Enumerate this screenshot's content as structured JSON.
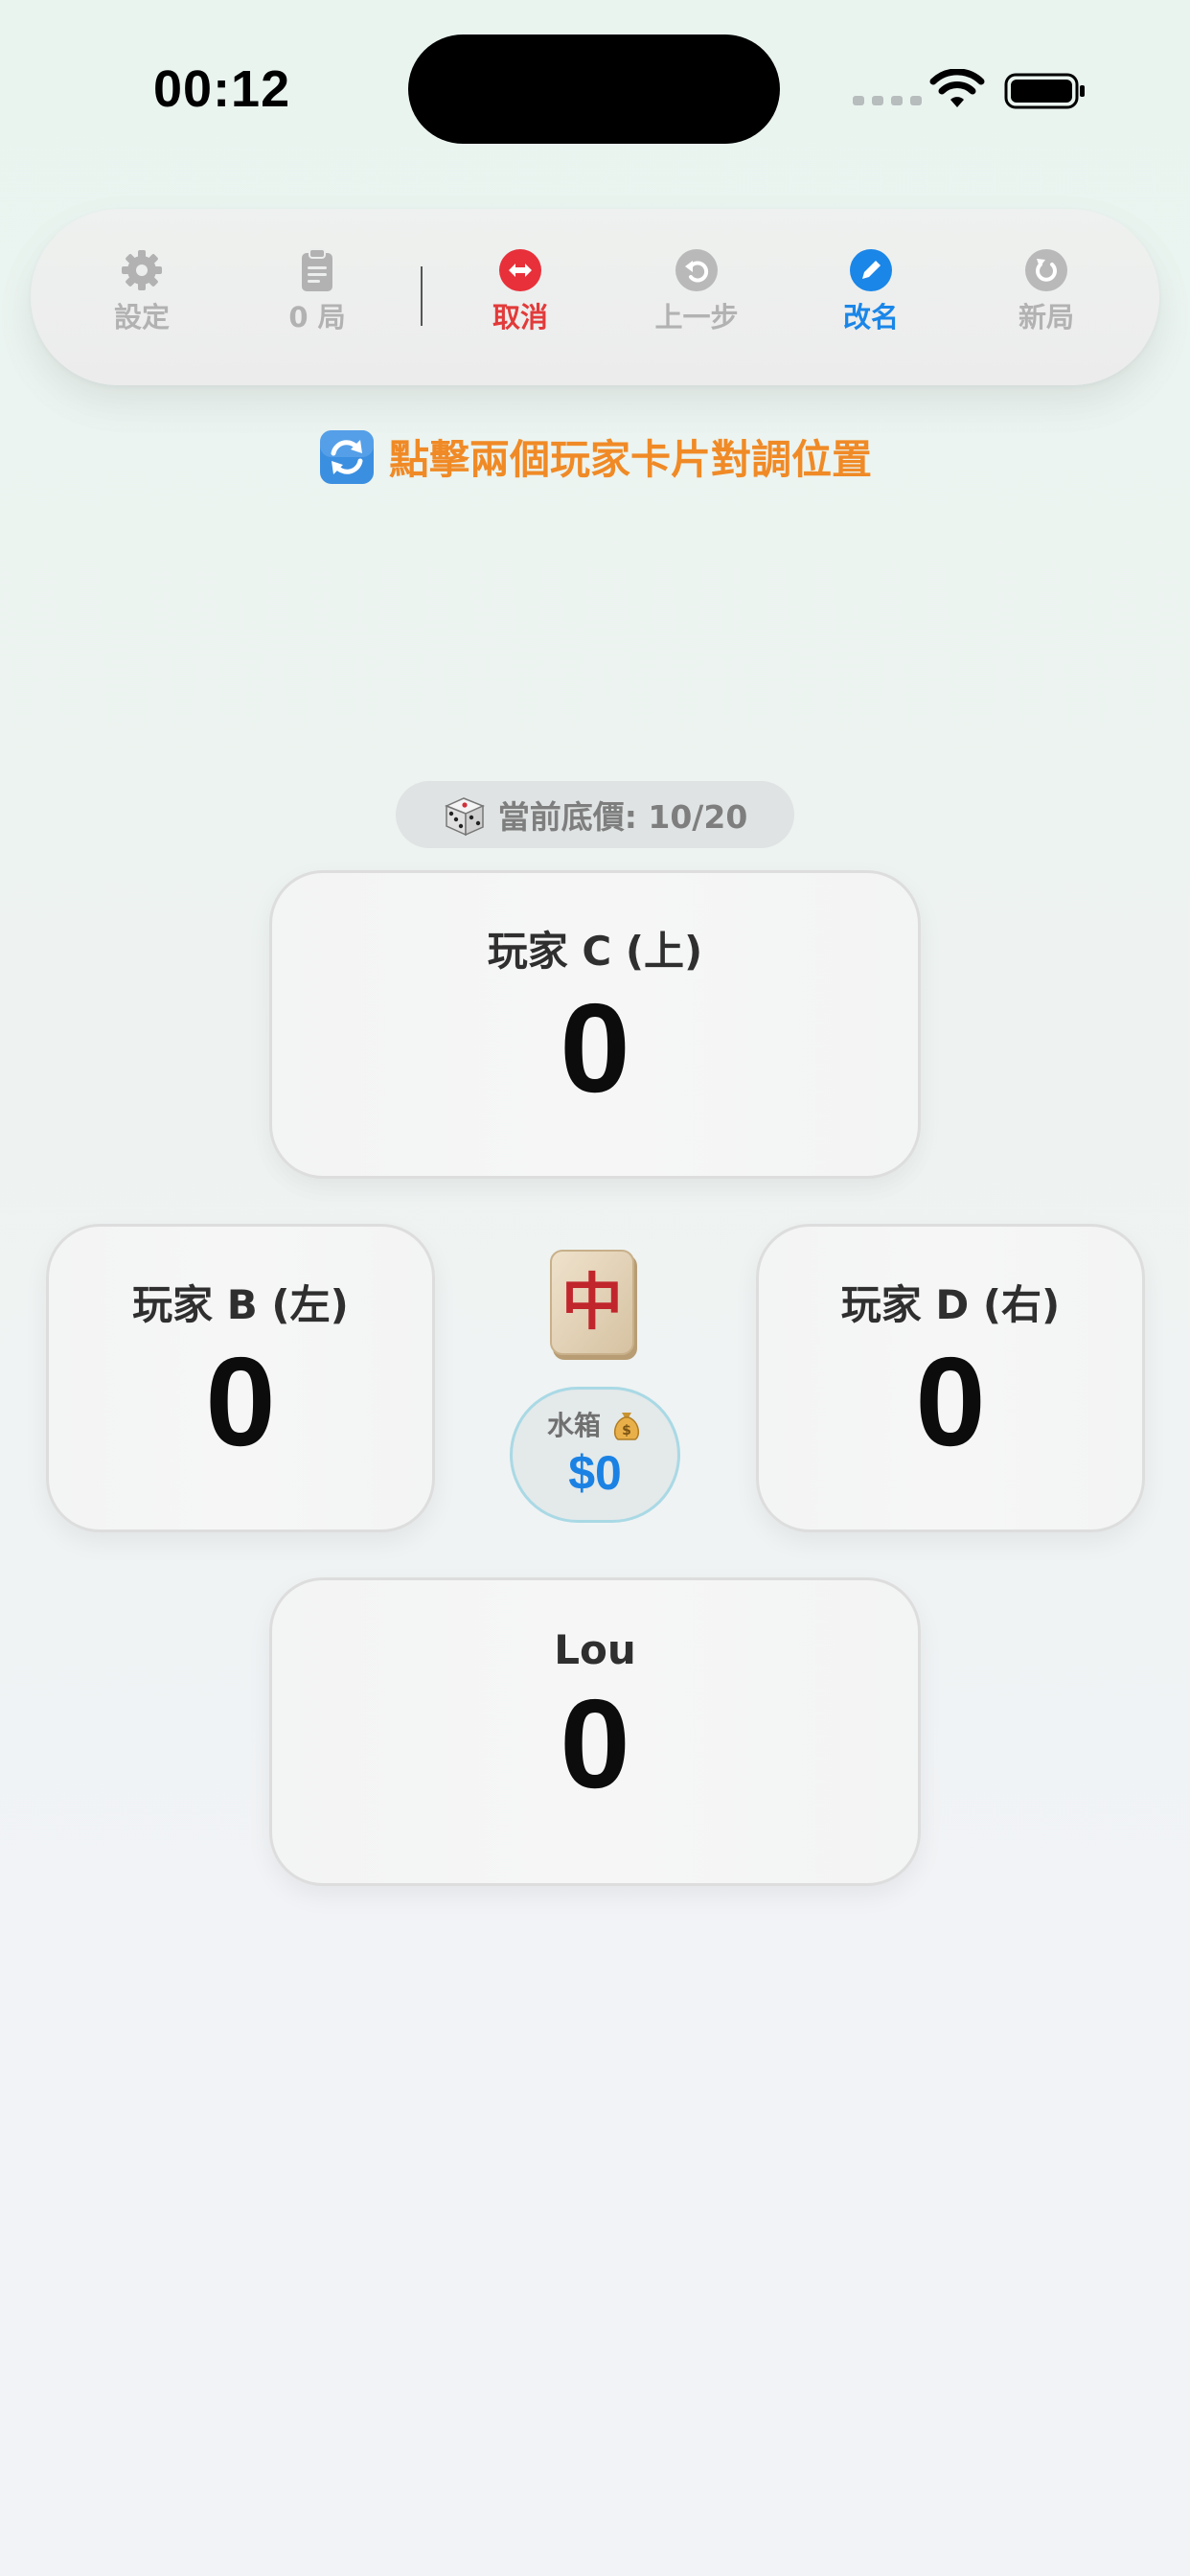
{
  "status_bar": {
    "time": "00:12"
  },
  "toolbar": {
    "items": [
      {
        "key": "settings",
        "label": "設定",
        "icon": "gear-icon"
      },
      {
        "key": "rounds",
        "label": "0 局",
        "icon": "clipboard-icon"
      },
      {
        "key": "cancel",
        "label": "取消",
        "icon": "swap-arrows-icon"
      },
      {
        "key": "undo",
        "label": "上一步",
        "icon": "undo-icon"
      },
      {
        "key": "rename",
        "label": "改名",
        "icon": "pencil-icon"
      },
      {
        "key": "new_game",
        "label": "新局",
        "icon": "refresh-icon"
      }
    ],
    "colors": {
      "inactive": "#b2b2b2",
      "cancel": "#e23a3a",
      "rename": "#1a86e8"
    }
  },
  "hint": {
    "text": "點擊兩個玩家卡片對調位置",
    "icon": "swap-icon"
  },
  "base_price": {
    "text": "當前底價: 10/20",
    "icon": "dice-icon"
  },
  "players": {
    "top": {
      "name": "玩家 C (上)",
      "score": "0"
    },
    "left": {
      "name": "玩家 B (左)",
      "score": "0"
    },
    "right": {
      "name": "玩家 D (右)",
      "score": "0"
    },
    "bottom": {
      "name": "Lou",
      "score": "0"
    }
  },
  "center": {
    "tile": {
      "icon": "mahjong-red-dragon-tile",
      "glyph": "中"
    },
    "pot": {
      "label": "水箱",
      "value": "$0",
      "icon": "money-bag-icon"
    }
  }
}
